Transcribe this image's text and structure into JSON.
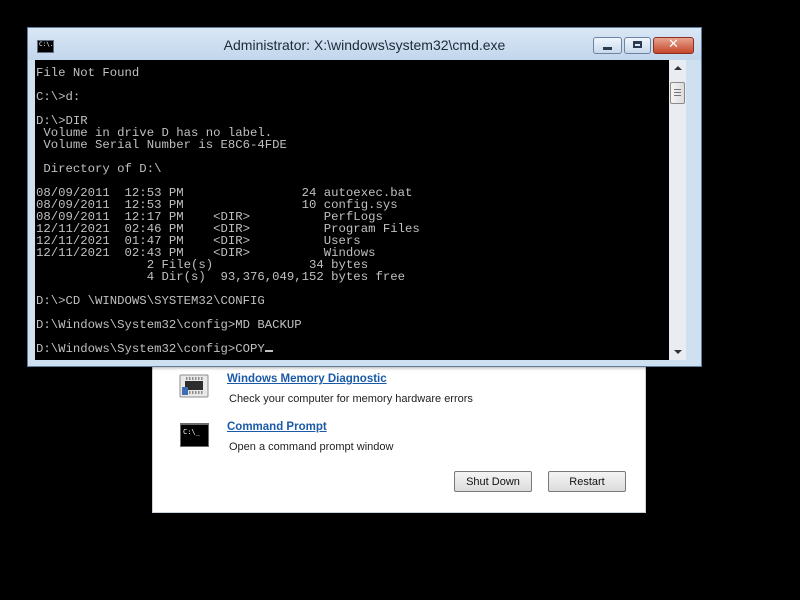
{
  "window": {
    "title": "Administrator: X:\\windows\\system32\\cmd.exe",
    "icon": "cmd-icon",
    "icon_text": "C:\\."
  },
  "console": {
    "lines": [
      "File Not Found",
      "",
      "C:\\>d:",
      "",
      "D:\\>DIR",
      " Volume in drive D has no label.",
      " Volume Serial Number is E8C6-4FDE",
      "",
      " Directory of D:\\",
      "",
      "08/09/2011  12:53 PM                24 autoexec.bat",
      "08/09/2011  12:53 PM                10 config.sys",
      "08/09/2011  12:17 PM    <DIR>          PerfLogs",
      "12/11/2021  02:46 PM    <DIR>          Program Files",
      "12/11/2021  01:47 PM    <DIR>          Users",
      "12/11/2021  02:43 PM    <DIR>          Windows",
      "               2 File(s)             34 bytes",
      "               4 Dir(s)  93,376,049,152 bytes free",
      "",
      "D:\\>CD \\WINDOWS\\SYSTEM32\\CONFIG",
      "",
      "D:\\Windows\\System32\\config>MD BACKUP",
      "",
      "D:\\Windows\\System32\\config>COPY"
    ],
    "colors": {
      "background": "#000000",
      "text": "#c0c0c0"
    }
  },
  "recovery": {
    "options": [
      {
        "title": "Windows Memory Diagnostic",
        "description": "Check your computer for memory hardware errors",
        "icon": "memory-chip-icon"
      },
      {
        "title": "Command Prompt",
        "description": "Open a command prompt window",
        "icon": "command-prompt-icon"
      }
    ],
    "buttons": {
      "shutdown": "Shut Down",
      "restart": "Restart"
    },
    "link_color": "#1a5aa8"
  }
}
